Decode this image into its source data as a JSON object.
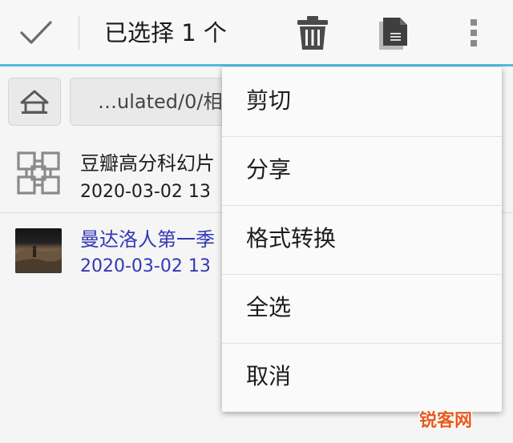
{
  "action_bar": {
    "selection_title": "已选择 1 个",
    "accent_color": "#53b9e0"
  },
  "path_bar": {
    "path_text": "…ulated/0/相"
  },
  "files": [
    {
      "name": "豆瓣高分科幻片",
      "date": "2020-03-02 13",
      "icon": "grid-file-icon",
      "selected": false
    },
    {
      "name": "曼达洛人第一季",
      "date": "2020-03-02 13",
      "icon": "video-thumbnail",
      "selected": true,
      "selected_color": "#3338b5"
    }
  ],
  "menu": {
    "items": [
      {
        "label": "剪切"
      },
      {
        "label": "分享"
      },
      {
        "label": "格式转换"
      },
      {
        "label": "全选"
      },
      {
        "label": "取消"
      }
    ]
  },
  "watermark": {
    "text": "锐客网",
    "color": "#e85a1e"
  }
}
